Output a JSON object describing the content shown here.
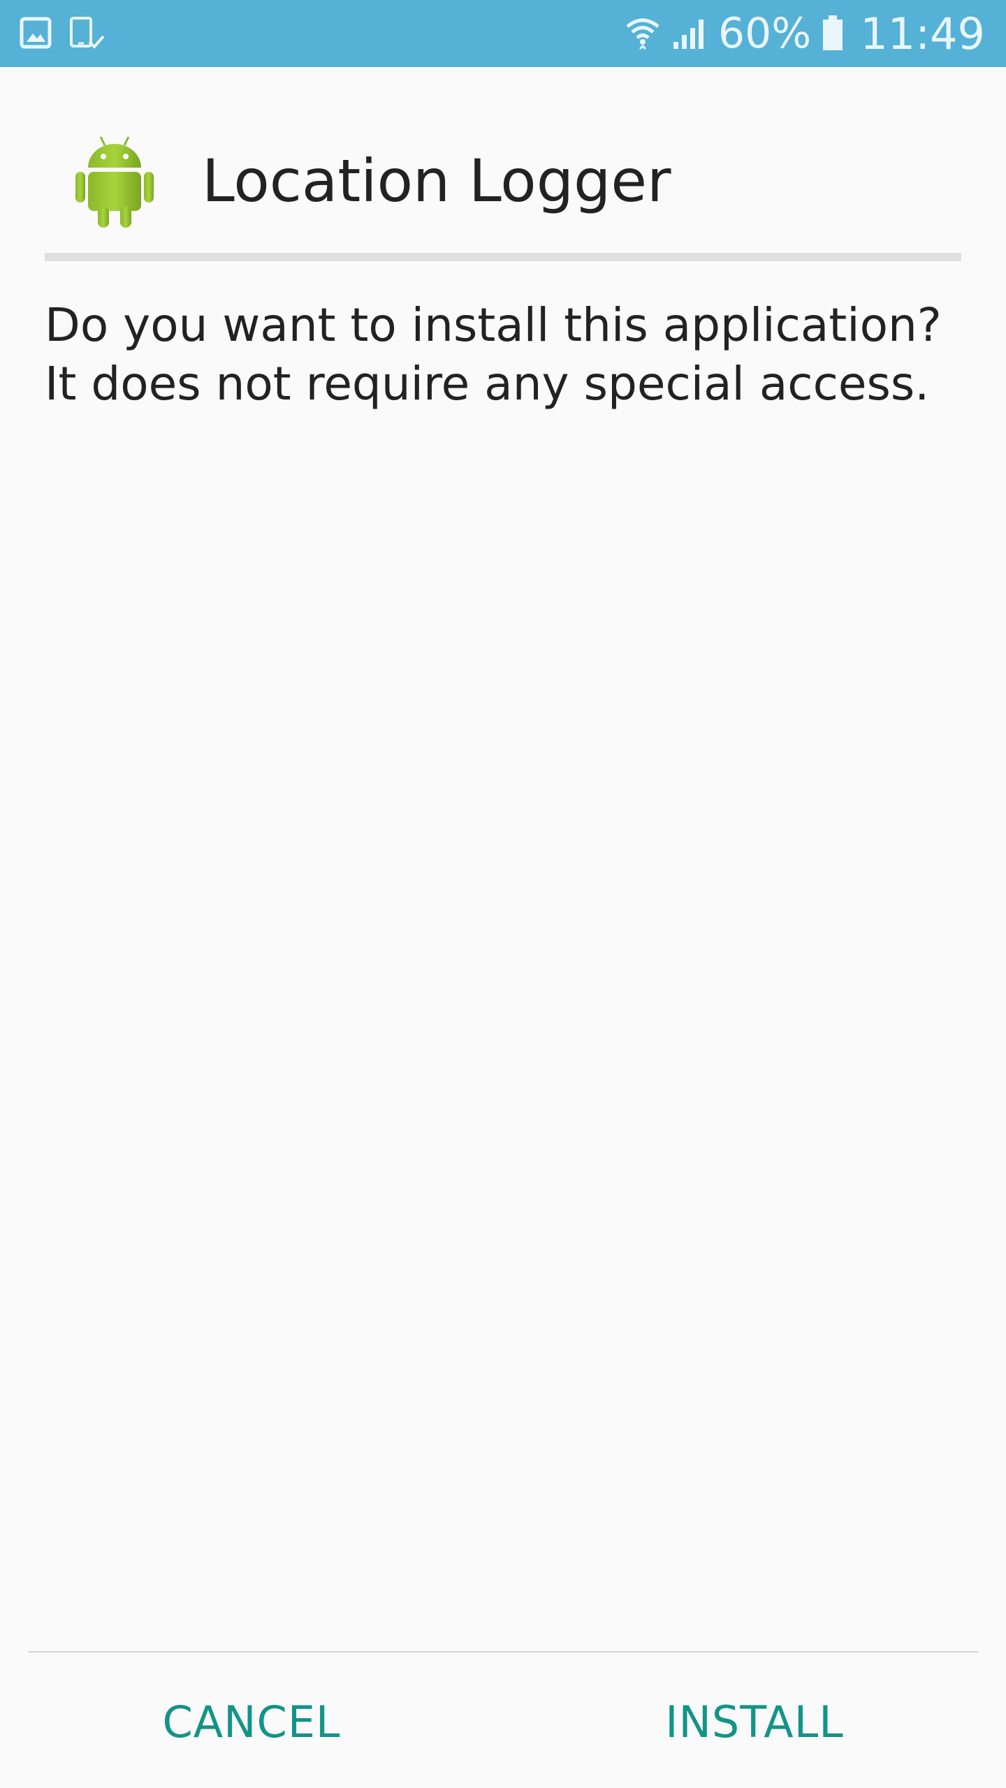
{
  "status_bar": {
    "left_icons": [
      "image-notification-icon",
      "device-check-icon"
    ],
    "wifi_icon": "wifi-icon",
    "signal_icon": "cell-signal-icon",
    "battery_percent": "60%",
    "battery_icon": "battery-icon",
    "time": "11:49",
    "background_color": "#55b1d6"
  },
  "app": {
    "icon": "android-robot-icon",
    "title": "Location Logger"
  },
  "message": "Do you want to install this application? It does not require any special access.",
  "actions": {
    "cancel_label": "CANCEL",
    "install_label": "INSTALL",
    "accent_color": "#129488"
  }
}
